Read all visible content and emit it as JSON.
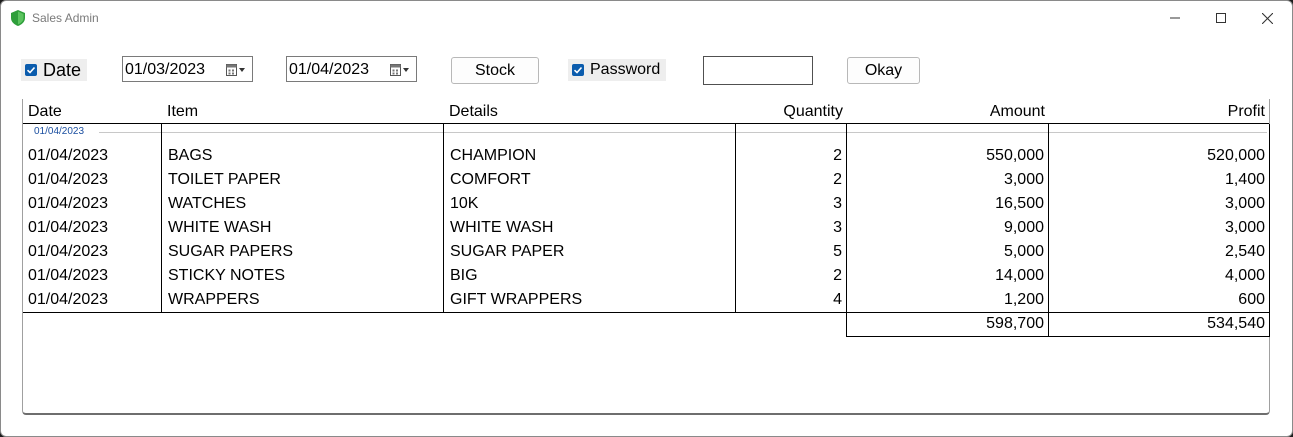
{
  "window": {
    "title": "Sales Admin"
  },
  "toolbar": {
    "date_checkbox_label": "Date",
    "date_from": "01/03/2023",
    "date_to": "01/04/2023",
    "stock_button": "Stock",
    "password_checkbox_label": "Password",
    "password_value": "",
    "okay_button": "Okay"
  },
  "table": {
    "columns": [
      "Date",
      "Item",
      "Details",
      "Quantity",
      "Amount",
      "Profit"
    ],
    "group_label": "01/04/2023",
    "rows": [
      [
        "01/04/2023",
        "BAGS",
        "CHAMPION",
        "2",
        "550,000",
        "520,000"
      ],
      [
        "01/04/2023",
        "TOILET PAPER",
        "COMFORT",
        "2",
        "3,000",
        "1,400"
      ],
      [
        "01/04/2023",
        "WATCHES",
        "10K",
        "3",
        "16,500",
        "3,000"
      ],
      [
        "01/04/2023",
        "WHITE WASH",
        "WHITE WASH",
        "3",
        "9,000",
        "3,000"
      ],
      [
        "01/04/2023",
        "SUGAR PAPERS",
        "SUGAR PAPER",
        "5",
        "5,000",
        "2,540"
      ],
      [
        "01/04/2023",
        "STICKY NOTES",
        "BIG",
        "2",
        "14,000",
        "4,000"
      ],
      [
        "01/04/2023",
        "WRAPPERS",
        "GIFT WRAPPERS",
        "4",
        "1,200",
        "600"
      ]
    ],
    "totals": {
      "amount": "598,700",
      "profit": "534,540"
    }
  },
  "colors": {
    "accent": "#0b5cad",
    "shield": "#2e9e3a",
    "group_text": "#1b4fa0"
  }
}
